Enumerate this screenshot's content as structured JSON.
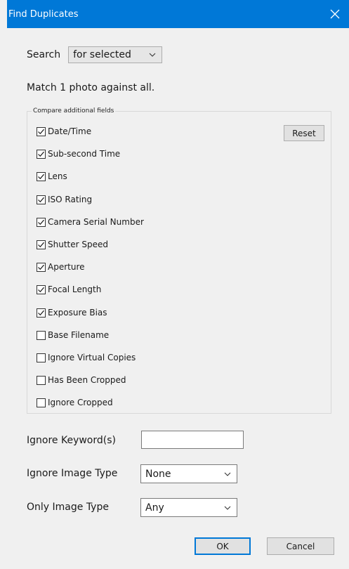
{
  "window": {
    "title": "Find Duplicates"
  },
  "search": {
    "label": "Search",
    "selected": "for selected"
  },
  "match_text": "Match 1 photo against all.",
  "compare_group": {
    "legend": "Compare additional fields",
    "reset_label": "Reset",
    "fields": [
      {
        "label": "Date/Time",
        "checked": true
      },
      {
        "label": "Sub-second Time",
        "checked": true
      },
      {
        "label": "Lens",
        "checked": true
      },
      {
        "label": "ISO Rating",
        "checked": true
      },
      {
        "label": "Camera Serial Number",
        "checked": true
      },
      {
        "label": "Shutter Speed",
        "checked": true
      },
      {
        "label": "Aperture",
        "checked": true
      },
      {
        "label": "Focal Length",
        "checked": true
      },
      {
        "label": "Exposure Bias",
        "checked": true
      },
      {
        "label": "Base Filename",
        "checked": false
      },
      {
        "label": "Ignore Virtual Copies",
        "checked": false
      },
      {
        "label": "Has Been Cropped",
        "checked": false
      },
      {
        "label": "Ignore Cropped",
        "checked": false
      }
    ]
  },
  "ignore_keywords": {
    "label": "Ignore Keyword(s)",
    "value": ""
  },
  "ignore_image_type": {
    "label": "Ignore Image Type",
    "selected": "None"
  },
  "only_image_type": {
    "label": "Only Image Type",
    "selected": "Any"
  },
  "buttons": {
    "ok": "OK",
    "cancel": "Cancel"
  },
  "colors": {
    "titlebar": "#0078d7",
    "default_button_border": "#0078d7"
  }
}
